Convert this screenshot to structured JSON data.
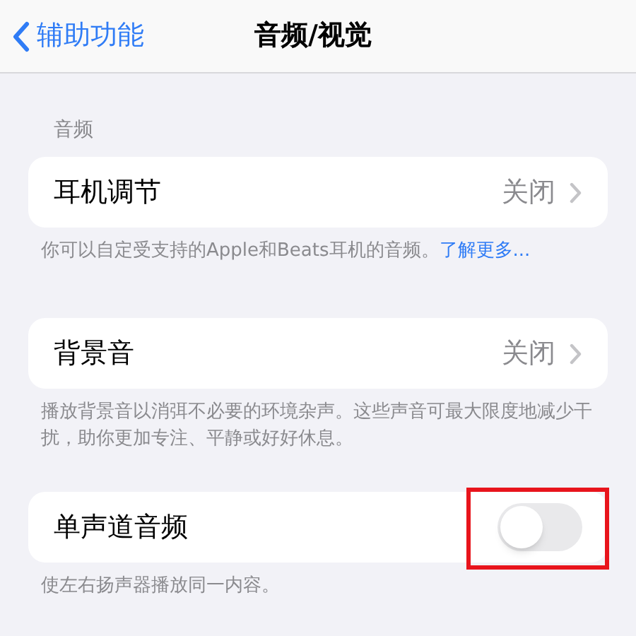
{
  "nav": {
    "back_label": "辅助功能",
    "title": "音频/视觉"
  },
  "sections": [
    {
      "header": "音频",
      "rows": [
        {
          "kind": "value",
          "label": "耳机调节",
          "value": "关闭"
        }
      ],
      "footer": "你可以自定受支持的Apple和Beats耳机的音频。",
      "footer_link": "了解更多..."
    },
    {
      "rows": [
        {
          "kind": "value",
          "label": "背景音",
          "value": "关闭"
        }
      ],
      "footer": "播放背景音以消弭不必要的环境杂声。这些声音可最大限度地减少干扰，助你更加专注、平静或好好休息。"
    },
    {
      "rows": [
        {
          "kind": "toggle",
          "label": "单声道音频",
          "on": false,
          "highlighted": true
        }
      ],
      "footer": "使左右扬声器播放同一内容。"
    }
  ]
}
